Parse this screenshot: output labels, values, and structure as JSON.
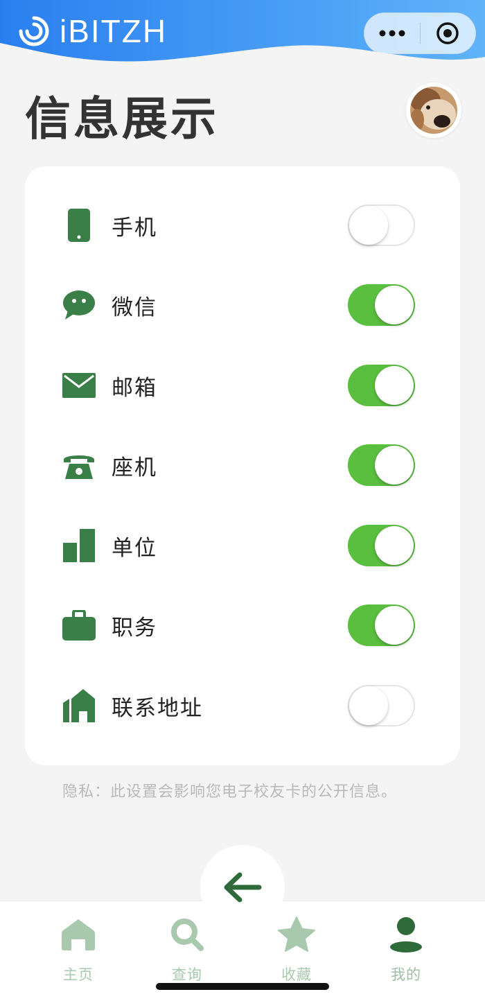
{
  "header": {
    "brand": "iBITZH",
    "gradient_start": "#2a7ff0",
    "gradient_end": "#5fb3f9"
  },
  "page": {
    "title": "信息展示"
  },
  "settings": [
    {
      "label": "手机",
      "icon": "phone-icon",
      "on": false
    },
    {
      "label": "微信",
      "icon": "wechat-icon",
      "on": true
    },
    {
      "label": "邮箱",
      "icon": "mail-icon",
      "on": true
    },
    {
      "label": "座机",
      "icon": "landline-icon",
      "on": true
    },
    {
      "label": "单位",
      "icon": "building-icon",
      "on": true
    },
    {
      "label": "职务",
      "icon": "briefcase-icon",
      "on": true
    },
    {
      "label": "联系地址",
      "icon": "home-address-icon",
      "on": false
    }
  ],
  "privacy_note": "隐私：此设置会影响您电子校友卡的公开信息。",
  "tabbar": [
    {
      "label": "主页",
      "icon": "home-icon"
    },
    {
      "label": "查询",
      "icon": "search-icon"
    },
    {
      "label": "收藏",
      "icon": "star-icon"
    },
    {
      "label": "我的",
      "icon": "user-icon",
      "active": true
    }
  ],
  "colors": {
    "accent_green": "#3a7f47",
    "toggle_on": "#5abe3f",
    "tab_inactive": "#a8c9ae"
  }
}
